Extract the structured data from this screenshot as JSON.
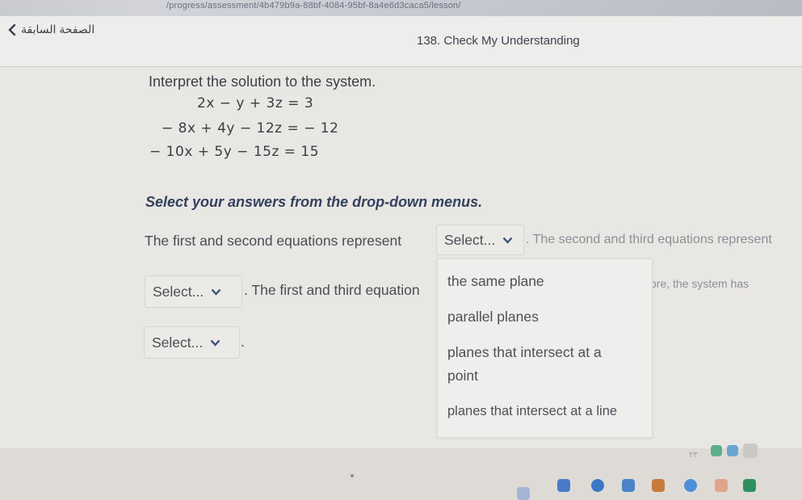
{
  "browser": {
    "url": "/progress/assessment/4b479b9a-88bf-4084-95bf-8a4e6d3caca5/lesson/"
  },
  "header": {
    "back_label": "الصفحة السابقة",
    "lesson_title": "138. Check My Understanding"
  },
  "question": {
    "prompt": "Interpret the solution to the system.",
    "equations": [
      "2x − y + 3z = 3",
      "− 8x + 4y − 12z = − 12",
      "− 10x + 5y − 15z = 15"
    ],
    "instruction": "Select your answers from the drop-down menus.",
    "sentence1_start": "The first and second equations represent",
    "sentence1_end": ". The second and third equations represent",
    "sentence2_mid": ". The first and third equation",
    "sentence2_end": "ore, the system has",
    "sentence3_end": "."
  },
  "selects": {
    "placeholder": "Select..."
  },
  "dropdown": {
    "options": [
      "the same plane",
      "parallel planes",
      "planes that intersect at a point",
      "planes that intersect at a line"
    ],
    "option3_line1": "planes that intersect at a",
    "option3_line2": "point"
  },
  "taskbar": {
    "clock_fragment": "٢٣"
  },
  "colors": {
    "instruction": "#33415e",
    "background": "#e9e7e4",
    "dropdown_bg": "#efeeec"
  }
}
